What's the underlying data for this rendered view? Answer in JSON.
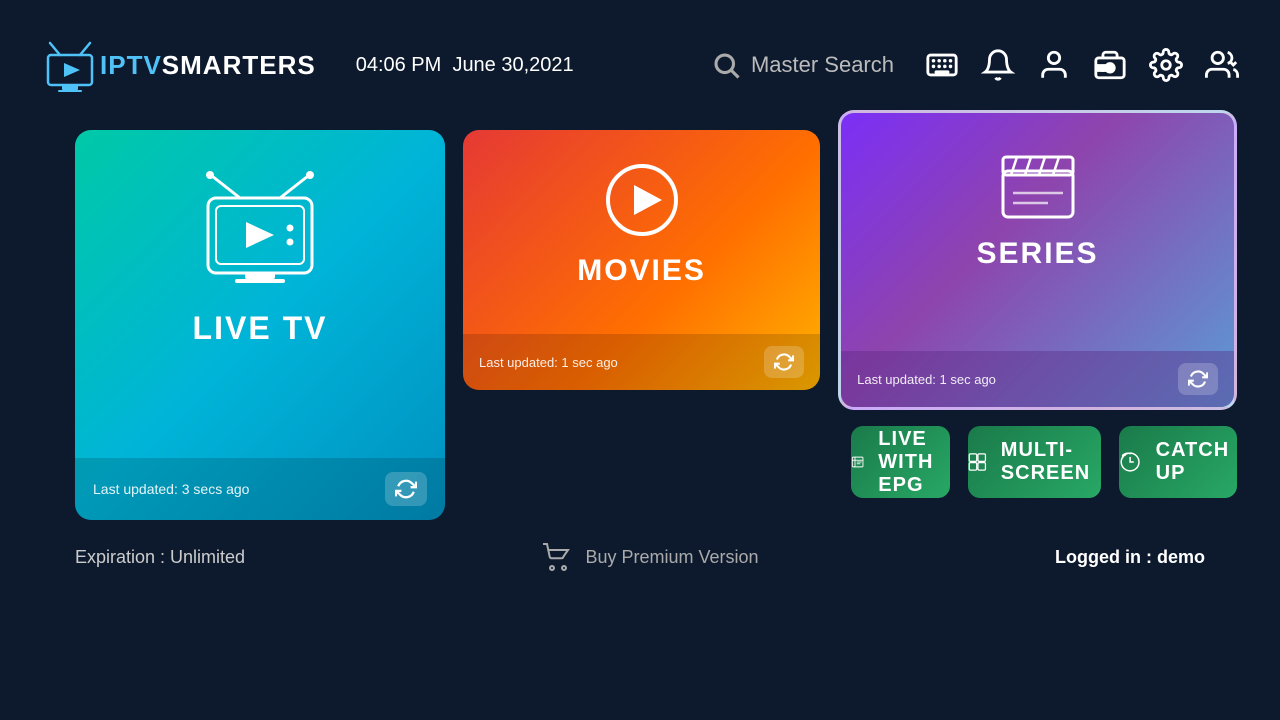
{
  "header": {
    "logo_iptv": "IPTV",
    "logo_smarters": "SMARTERS",
    "time": "04:06 PM",
    "date": "June 30,2021",
    "search_label": "Master Search",
    "icons": {
      "keyboard": "⌨",
      "bell": "🔔",
      "profile": "👤",
      "record": "REC",
      "settings": "⚙",
      "users": "👥"
    }
  },
  "cards": {
    "live_tv": {
      "title": "LIVE TV",
      "last_updated": "Last updated: 3 secs ago"
    },
    "movies": {
      "title": "MOVIES",
      "last_updated": "Last updated: 1 sec ago"
    },
    "series": {
      "title": "SERIES",
      "last_updated": "Last updated: 1 sec ago"
    }
  },
  "bottom_buttons": {
    "epg": {
      "label": "LIVE WITH EPG"
    },
    "multiscreen": {
      "label": "MULTI-SCREEN"
    },
    "catchup": {
      "label": "CATCH UP"
    }
  },
  "footer": {
    "expiration": "Expiration : Unlimited",
    "buy_premium": "Buy Premium Version",
    "logged_in_label": "Logged in : ",
    "username": "demo"
  }
}
